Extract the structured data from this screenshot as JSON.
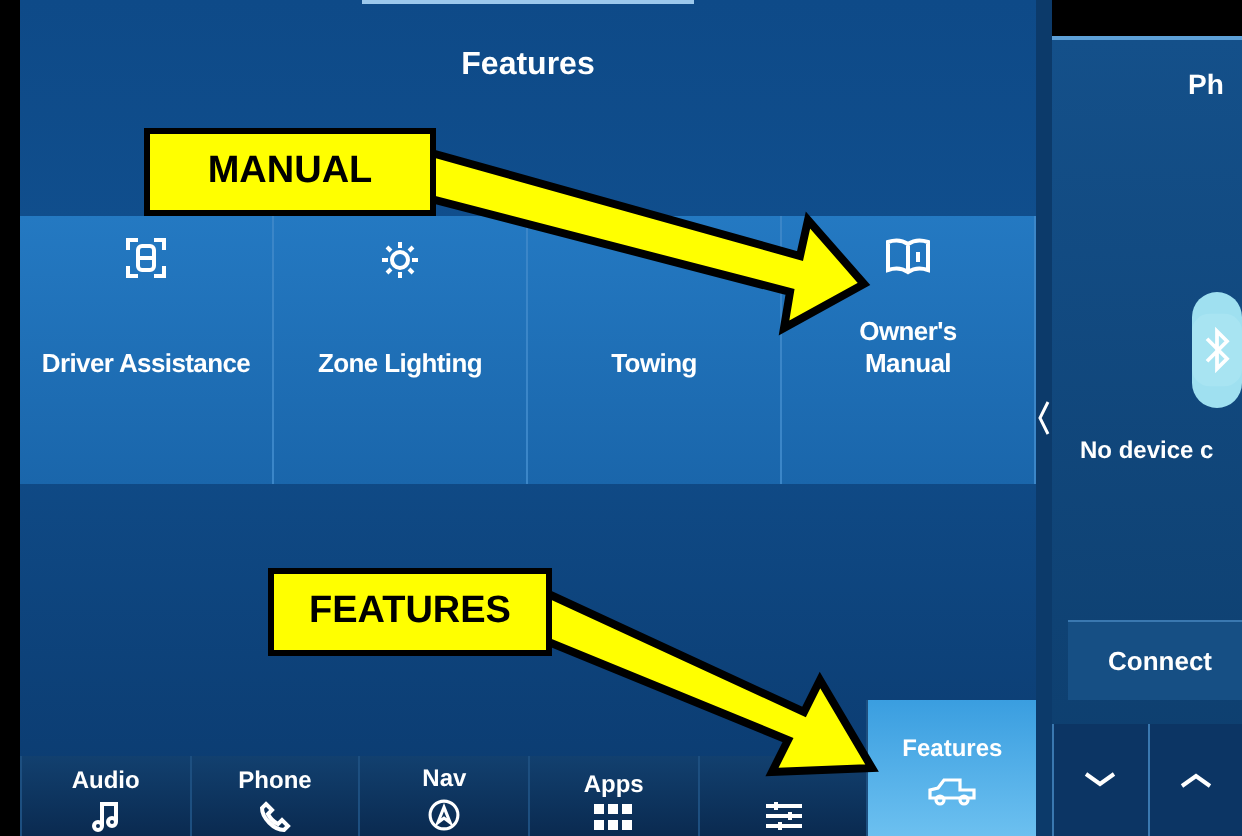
{
  "header": {
    "title": "Features"
  },
  "tiles": [
    {
      "label": "Driver Assistance"
    },
    {
      "label": "Zone Lighting"
    },
    {
      "label": "Towing"
    },
    {
      "label": "Owner's Manual"
    }
  ],
  "nav": [
    {
      "label": "Audio",
      "selected": false
    },
    {
      "label": "Phone",
      "selected": false
    },
    {
      "label": "Nav",
      "selected": false
    },
    {
      "label": "Apps",
      "selected": false
    },
    {
      "selected": false
    },
    {
      "label": "Features",
      "selected": true
    }
  ],
  "side_panel": {
    "title": "Ph",
    "message": "No device c",
    "button": "Connect"
  },
  "annotations": [
    {
      "label": "MANUAL"
    },
    {
      "label": "FEATURES"
    }
  ]
}
